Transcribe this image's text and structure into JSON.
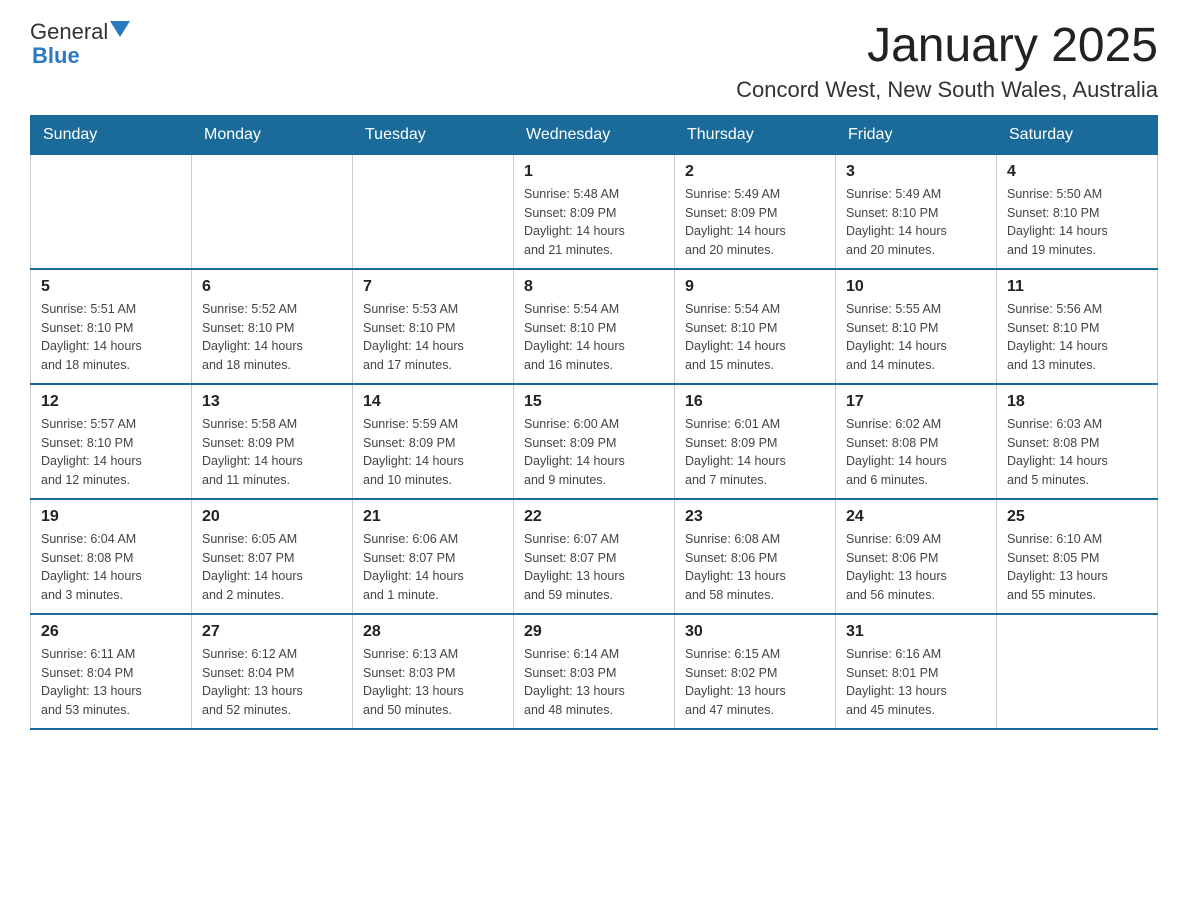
{
  "logo": {
    "text1": "General",
    "text2": "Blue"
  },
  "title": "January 2025",
  "subtitle": "Concord West, New South Wales, Australia",
  "days_of_week": [
    "Sunday",
    "Monday",
    "Tuesday",
    "Wednesday",
    "Thursday",
    "Friday",
    "Saturday"
  ],
  "weeks": [
    [
      {
        "day": "",
        "info": ""
      },
      {
        "day": "",
        "info": ""
      },
      {
        "day": "",
        "info": ""
      },
      {
        "day": "1",
        "info": "Sunrise: 5:48 AM\nSunset: 8:09 PM\nDaylight: 14 hours\nand 21 minutes."
      },
      {
        "day": "2",
        "info": "Sunrise: 5:49 AM\nSunset: 8:09 PM\nDaylight: 14 hours\nand 20 minutes."
      },
      {
        "day": "3",
        "info": "Sunrise: 5:49 AM\nSunset: 8:10 PM\nDaylight: 14 hours\nand 20 minutes."
      },
      {
        "day": "4",
        "info": "Sunrise: 5:50 AM\nSunset: 8:10 PM\nDaylight: 14 hours\nand 19 minutes."
      }
    ],
    [
      {
        "day": "5",
        "info": "Sunrise: 5:51 AM\nSunset: 8:10 PM\nDaylight: 14 hours\nand 18 minutes."
      },
      {
        "day": "6",
        "info": "Sunrise: 5:52 AM\nSunset: 8:10 PM\nDaylight: 14 hours\nand 18 minutes."
      },
      {
        "day": "7",
        "info": "Sunrise: 5:53 AM\nSunset: 8:10 PM\nDaylight: 14 hours\nand 17 minutes."
      },
      {
        "day": "8",
        "info": "Sunrise: 5:54 AM\nSunset: 8:10 PM\nDaylight: 14 hours\nand 16 minutes."
      },
      {
        "day": "9",
        "info": "Sunrise: 5:54 AM\nSunset: 8:10 PM\nDaylight: 14 hours\nand 15 minutes."
      },
      {
        "day": "10",
        "info": "Sunrise: 5:55 AM\nSunset: 8:10 PM\nDaylight: 14 hours\nand 14 minutes."
      },
      {
        "day": "11",
        "info": "Sunrise: 5:56 AM\nSunset: 8:10 PM\nDaylight: 14 hours\nand 13 minutes."
      }
    ],
    [
      {
        "day": "12",
        "info": "Sunrise: 5:57 AM\nSunset: 8:10 PM\nDaylight: 14 hours\nand 12 minutes."
      },
      {
        "day": "13",
        "info": "Sunrise: 5:58 AM\nSunset: 8:09 PM\nDaylight: 14 hours\nand 11 minutes."
      },
      {
        "day": "14",
        "info": "Sunrise: 5:59 AM\nSunset: 8:09 PM\nDaylight: 14 hours\nand 10 minutes."
      },
      {
        "day": "15",
        "info": "Sunrise: 6:00 AM\nSunset: 8:09 PM\nDaylight: 14 hours\nand 9 minutes."
      },
      {
        "day": "16",
        "info": "Sunrise: 6:01 AM\nSunset: 8:09 PM\nDaylight: 14 hours\nand 7 minutes."
      },
      {
        "day": "17",
        "info": "Sunrise: 6:02 AM\nSunset: 8:08 PM\nDaylight: 14 hours\nand 6 minutes."
      },
      {
        "day": "18",
        "info": "Sunrise: 6:03 AM\nSunset: 8:08 PM\nDaylight: 14 hours\nand 5 minutes."
      }
    ],
    [
      {
        "day": "19",
        "info": "Sunrise: 6:04 AM\nSunset: 8:08 PM\nDaylight: 14 hours\nand 3 minutes."
      },
      {
        "day": "20",
        "info": "Sunrise: 6:05 AM\nSunset: 8:07 PM\nDaylight: 14 hours\nand 2 minutes."
      },
      {
        "day": "21",
        "info": "Sunrise: 6:06 AM\nSunset: 8:07 PM\nDaylight: 14 hours\nand 1 minute."
      },
      {
        "day": "22",
        "info": "Sunrise: 6:07 AM\nSunset: 8:07 PM\nDaylight: 13 hours\nand 59 minutes."
      },
      {
        "day": "23",
        "info": "Sunrise: 6:08 AM\nSunset: 8:06 PM\nDaylight: 13 hours\nand 58 minutes."
      },
      {
        "day": "24",
        "info": "Sunrise: 6:09 AM\nSunset: 8:06 PM\nDaylight: 13 hours\nand 56 minutes."
      },
      {
        "day": "25",
        "info": "Sunrise: 6:10 AM\nSunset: 8:05 PM\nDaylight: 13 hours\nand 55 minutes."
      }
    ],
    [
      {
        "day": "26",
        "info": "Sunrise: 6:11 AM\nSunset: 8:04 PM\nDaylight: 13 hours\nand 53 minutes."
      },
      {
        "day": "27",
        "info": "Sunrise: 6:12 AM\nSunset: 8:04 PM\nDaylight: 13 hours\nand 52 minutes."
      },
      {
        "day": "28",
        "info": "Sunrise: 6:13 AM\nSunset: 8:03 PM\nDaylight: 13 hours\nand 50 minutes."
      },
      {
        "day": "29",
        "info": "Sunrise: 6:14 AM\nSunset: 8:03 PM\nDaylight: 13 hours\nand 48 minutes."
      },
      {
        "day": "30",
        "info": "Sunrise: 6:15 AM\nSunset: 8:02 PM\nDaylight: 13 hours\nand 47 minutes."
      },
      {
        "day": "31",
        "info": "Sunrise: 6:16 AM\nSunset: 8:01 PM\nDaylight: 13 hours\nand 45 minutes."
      },
      {
        "day": "",
        "info": ""
      }
    ]
  ]
}
